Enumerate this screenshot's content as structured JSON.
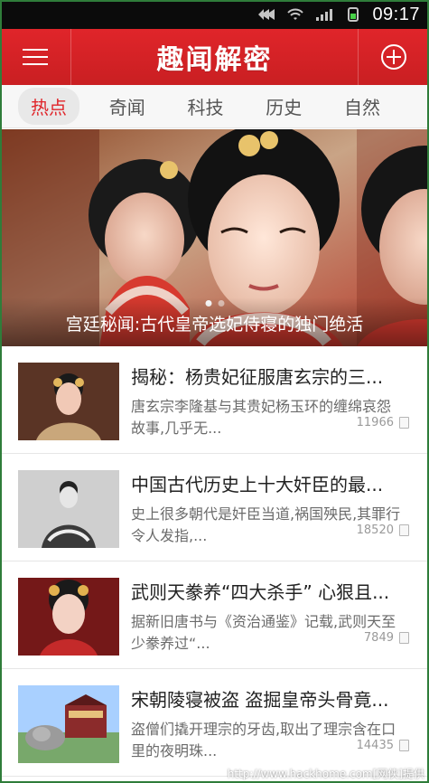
{
  "status_bar": {
    "time": "09:17",
    "icons": [
      "signal-icon",
      "wifi-icon",
      "cellular-icon",
      "battery-icon"
    ]
  },
  "app_bar": {
    "title": "趣闻解密",
    "left_icon": "menu-icon",
    "right_icon": "add-circle-icon"
  },
  "tabs": [
    {
      "label": "热点",
      "active": true
    },
    {
      "label": "奇闻",
      "active": false
    },
    {
      "label": "科技",
      "active": false
    },
    {
      "label": "历史",
      "active": false
    },
    {
      "label": "自然",
      "active": false
    }
  ],
  "hero": {
    "caption": "宫廷秘闻:古代皇帝选妃侍寝的独门绝活",
    "dots_total": 2,
    "dots_active_index": 0
  },
  "feed": [
    {
      "title": "揭秘：杨贵妃征服唐玄宗的三...",
      "desc": "唐玄宗李隆基与其贵妃杨玉环的缠绵哀怨故事,几乎无...",
      "count": "11966",
      "thumb_icon": "portrait-thumbnail"
    },
    {
      "title": "中国古代历史上十大奸臣的最...",
      "desc": "史上很多朝代是奸臣当道,祸国殃民,其罪行令人发指,...",
      "count": "18520",
      "thumb_icon": "official-portrait-thumbnail"
    },
    {
      "title": "武则天豢养“四大杀手” 心狠且...",
      "desc": "据新旧唐书与《资治通鉴》记载,武则天至少豢养过“...",
      "count": "7849",
      "thumb_icon": "empress-thumbnail"
    },
    {
      "title": "宋朝陵寝被盗 盗掘皇帝头骨竟...",
      "desc": "盗僧们撬开理宗的牙齿,取出了理宗含在口里的夜明珠...",
      "count": "14435",
      "thumb_icon": "tomb-thumbnail"
    }
  ],
  "watermark": "http://www.hackhome.com[网侠]提供",
  "colors": {
    "brand_red": "#e0252a",
    "tab_active_bg": "#e8e8e8"
  }
}
